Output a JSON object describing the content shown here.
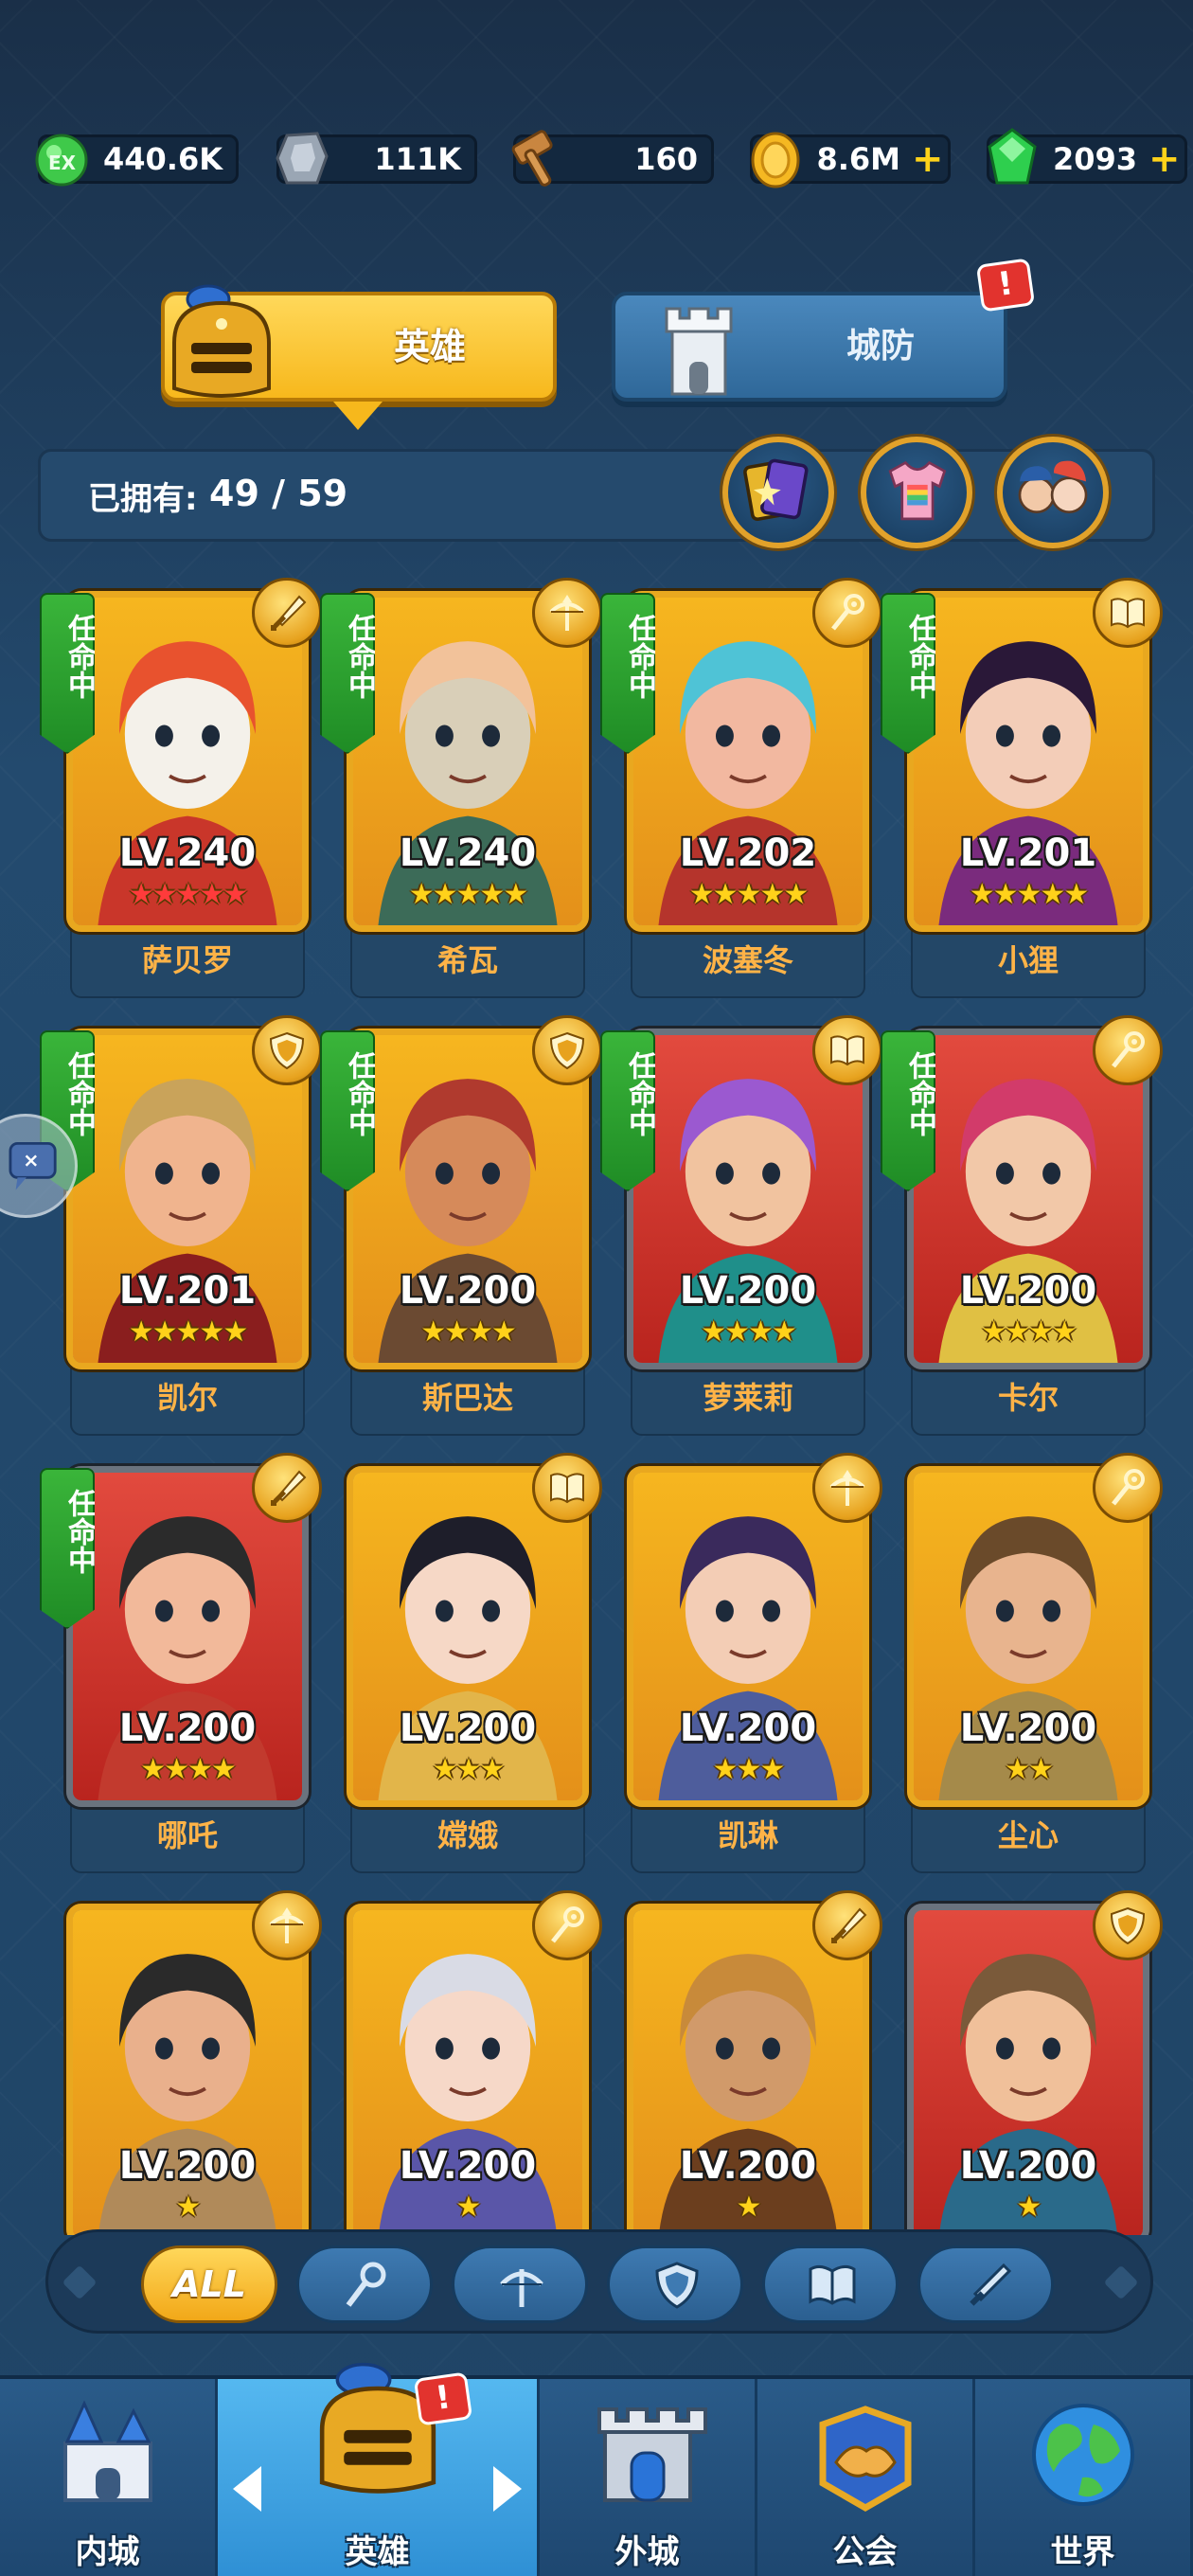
{
  "currencies": [
    {
      "icon": "green-gem-xp-icon",
      "value": "440.6K",
      "has_plus": false
    },
    {
      "icon": "stone-icon",
      "value": "111K",
      "has_plus": false
    },
    {
      "icon": "hammer-icon",
      "value": "160",
      "has_plus": false
    },
    {
      "icon": "gold-coin-icon",
      "value": "8.6M",
      "has_plus": true
    },
    {
      "icon": "emerald-icon",
      "value": "2093",
      "has_plus": true
    }
  ],
  "tabs": {
    "heroes_label": "英雄",
    "defense_label": "城防",
    "defense_alert": "!"
  },
  "owned": {
    "label": "已拥有:",
    "count": "49 / 59"
  },
  "ribbon_text": "任命中",
  "heroes": [
    {
      "name": "萨贝罗",
      "level": "LV.240",
      "stars": "★★★★★",
      "star_color": "red",
      "class": "sword-icon",
      "appointed": true,
      "frame": "gold"
    },
    {
      "name": "希瓦",
      "level": "LV.240",
      "stars": "★★★★★",
      "star_color": "gold",
      "class": "crossbow-icon",
      "appointed": true,
      "frame": "gold"
    },
    {
      "name": "波塞冬",
      "level": "LV.202",
      "stars": "★★★★★",
      "star_color": "gold",
      "class": "staff-icon",
      "appointed": true,
      "frame": "gold"
    },
    {
      "name": "小狸",
      "level": "LV.201",
      "stars": "★★★★★",
      "star_color": "gold",
      "class": "book-icon",
      "appointed": true,
      "frame": "gold"
    },
    {
      "name": "凯尔",
      "level": "LV.201",
      "stars": "★★★★★",
      "star_color": "gold",
      "class": "shield-icon",
      "appointed": true,
      "frame": "gold"
    },
    {
      "name": "斯巴达",
      "level": "LV.200",
      "stars": "★★★★",
      "star_color": "gold",
      "class": "shield-icon",
      "appointed": true,
      "frame": "gold"
    },
    {
      "name": "萝莱莉",
      "level": "LV.200",
      "stars": "★★★★",
      "star_color": "gold",
      "class": "book-icon",
      "appointed": true,
      "frame": "red"
    },
    {
      "name": "卡尔",
      "level": "LV.200",
      "stars": "★★★★",
      "star_color": "gold",
      "class": "staff-icon",
      "appointed": true,
      "frame": "red"
    },
    {
      "name": "哪吒",
      "level": "LV.200",
      "stars": "★★★★",
      "star_color": "gold",
      "class": "sword-icon",
      "appointed": true,
      "frame": "red"
    },
    {
      "name": "嫦娥",
      "level": "LV.200",
      "stars": "★★★",
      "star_color": "gold",
      "class": "book-icon",
      "appointed": false,
      "frame": "gold"
    },
    {
      "name": "凯琳",
      "level": "LV.200",
      "stars": "★★★",
      "star_color": "gold",
      "class": "crossbow-icon",
      "appointed": false,
      "frame": "gold"
    },
    {
      "name": "尘心",
      "level": "LV.200",
      "stars": "★★",
      "star_color": "gold",
      "class": "staff-icon",
      "appointed": false,
      "frame": "gold"
    },
    {
      "name": "",
      "level": "LV.200",
      "stars": "★",
      "star_color": "gold",
      "class": "crossbow-icon",
      "appointed": false,
      "frame": "gold"
    },
    {
      "name": "",
      "level": "LV.200",
      "stars": "★",
      "star_color": "gold",
      "class": "staff-icon",
      "appointed": false,
      "frame": "gold"
    },
    {
      "name": "",
      "level": "LV.200",
      "stars": "★",
      "star_color": "gold",
      "class": "sword-icon",
      "appointed": false,
      "frame": "gold"
    },
    {
      "name": "",
      "level": "LV.200",
      "stars": "★",
      "star_color": "gold",
      "class": "shield-icon",
      "appointed": false,
      "frame": "red"
    }
  ],
  "filters": [
    {
      "label": "ALL",
      "icon": "",
      "active": true
    },
    {
      "label": "",
      "icon": "staff-icon",
      "active": false
    },
    {
      "label": "",
      "icon": "crossbow-icon",
      "active": false
    },
    {
      "label": "",
      "icon": "shield-icon",
      "active": false
    },
    {
      "label": "",
      "icon": "book-icon",
      "active": false
    },
    {
      "label": "",
      "icon": "sword-icon",
      "active": false
    }
  ],
  "bottom_nav": [
    {
      "label": "内城",
      "icon": "castle-icon",
      "active": false
    },
    {
      "label": "英雄",
      "icon": "knight-helmet-icon",
      "active": true,
      "alert": "!"
    },
    {
      "label": "外城",
      "icon": "tower-gate-icon",
      "active": false
    },
    {
      "label": "公会",
      "icon": "handshake-icon",
      "active": false
    },
    {
      "label": "世界",
      "icon": "globe-icon",
      "active": false
    }
  ],
  "colors": {
    "hero_name": "#ffb347",
    "gold_frame": "#e9a81f",
    "silver_frame": "#6a737e",
    "appointed_ribbon": "#2a9f2e",
    "active_tab": "#f7b81c",
    "alert_red": "#e2332e"
  }
}
